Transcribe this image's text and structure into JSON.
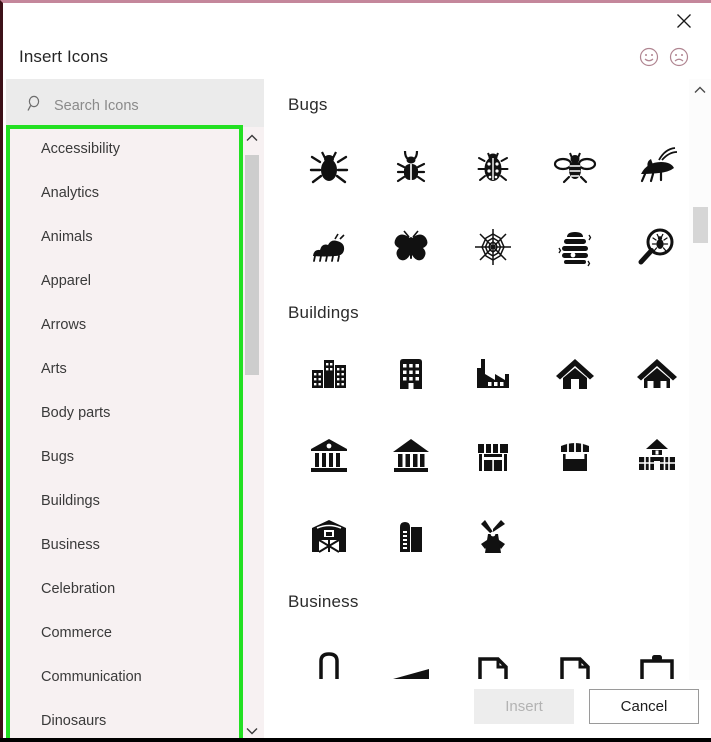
{
  "dialog": {
    "title": "Insert Icons",
    "close_label": "×",
    "close_icon": "close-icon",
    "feedback_happy_icon": "smiley-happy-icon",
    "feedback_sad_icon": "smiley-sad-icon"
  },
  "search": {
    "placeholder": "Search Icons",
    "value": "",
    "icon": "search-icon"
  },
  "sidebar": {
    "items": [
      {
        "label": "Accessibility"
      },
      {
        "label": "Analytics"
      },
      {
        "label": "Animals"
      },
      {
        "label": "Apparel"
      },
      {
        "label": "Arrows"
      },
      {
        "label": "Arts"
      },
      {
        "label": "Body parts"
      },
      {
        "label": "Bugs"
      },
      {
        "label": "Buildings"
      },
      {
        "label": "Business"
      },
      {
        "label": "Celebration"
      },
      {
        "label": "Commerce"
      },
      {
        "label": "Communication"
      },
      {
        "label": "Dinosaurs"
      }
    ],
    "scroll_up_icon": "chevron-up-icon",
    "scroll_down_icon": "chevron-down-icon"
  },
  "gallery": {
    "scroll_up_icon": "chevron-up-icon",
    "scroll_down_icon": "chevron-down-icon",
    "sections": [
      {
        "title": "Bugs",
        "icons": [
          "beetle-icon",
          "bug-icon",
          "ladybug-icon",
          "bee-icon",
          "grasshopper-icon",
          "caterpillar-icon",
          "butterfly-icon",
          "spiderweb-icon",
          "beehive-icon",
          "bug-search-icon"
        ]
      },
      {
        "title": "Buildings",
        "icons": [
          "cityscape-icon",
          "office-building-icon",
          "factory-icon",
          "house-icon",
          "home-icon",
          "bank-icon",
          "museum-icon",
          "store-icon",
          "market-stall-icon",
          "school-icon",
          "barn-icon",
          "silo-icon",
          "windmill-icon"
        ]
      },
      {
        "title": "Business",
        "icons": [
          "arch-icon",
          "ramp-icon",
          "document-fold-icon",
          "document-fold-2-icon",
          "briefcase-icon"
        ]
      }
    ]
  },
  "footer": {
    "insert_label": "Insert",
    "cancel_label": "Cancel"
  },
  "colors": {
    "highlight": "#22e022",
    "panel_bg": "#f7f1f2",
    "search_bg": "#ebebeb",
    "accent_border": "#c4879b"
  }
}
